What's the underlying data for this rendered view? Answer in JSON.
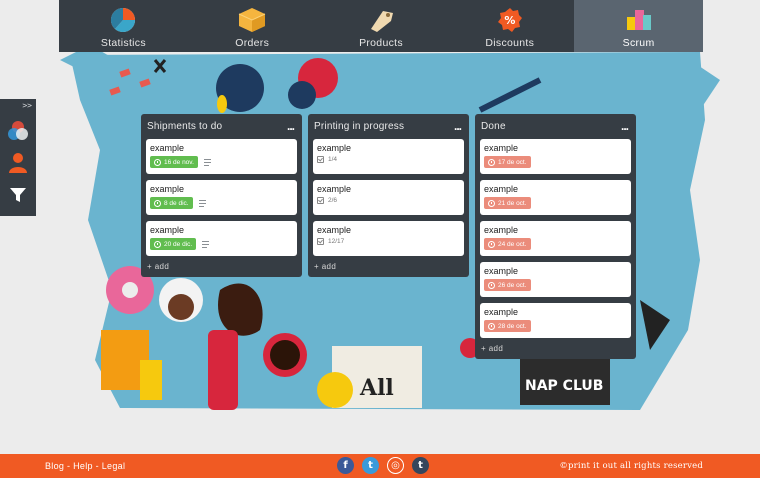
{
  "nav": {
    "items": [
      {
        "label": "Statistics",
        "icon": "pie-chart-icon",
        "active": false
      },
      {
        "label": "Orders",
        "icon": "box-icon",
        "active": false
      },
      {
        "label": "Products",
        "icon": "tag-icon",
        "active": false
      },
      {
        "label": "Discounts",
        "icon": "percent-icon",
        "active": false
      },
      {
        "label": "Scrum",
        "icon": "blocks-icon",
        "active": true
      }
    ]
  },
  "sidebar": {
    "expand_label": ">>",
    "icons": [
      "color-circles-icon",
      "user-icon",
      "filter-icon"
    ]
  },
  "board": {
    "lists": [
      {
        "title": "Shipments to do",
        "menu": "...",
        "add_label": "+ add",
        "cards": [
          {
            "title": "example",
            "due": "16 de nov.",
            "status": "green",
            "has_description": true
          },
          {
            "title": "example",
            "due": "8 de dic.",
            "status": "green",
            "has_description": true
          },
          {
            "title": "example",
            "due": "20 de dic.",
            "status": "green",
            "has_description": true
          }
        ]
      },
      {
        "title": "Printing in progress",
        "menu": "...",
        "add_label": "+ add",
        "cards": [
          {
            "title": "example",
            "checklist": "1/4"
          },
          {
            "title": "example",
            "checklist": "2/6"
          },
          {
            "title": "example",
            "checklist": "12/17"
          }
        ]
      },
      {
        "title": "Done",
        "menu": "...",
        "add_label": "+ add",
        "cards": [
          {
            "title": "example",
            "due": "17 de oct.",
            "status": "red"
          },
          {
            "title": "example",
            "due": "21 de oct.",
            "status": "red"
          },
          {
            "title": "example",
            "due": "24 de oct.",
            "status": "red"
          },
          {
            "title": "example",
            "due": "26 de oct.",
            "status": "red"
          },
          {
            "title": "example",
            "due": "28 de oct.",
            "status": "red"
          }
        ]
      }
    ]
  },
  "footer": {
    "links": "Blog - Help - Legal",
    "social": [
      {
        "name": "facebook-icon",
        "glyph": "f",
        "color": "#3b5998"
      },
      {
        "name": "twitter-icon",
        "glyph": "t",
        "color": "#3a9ad9"
      },
      {
        "name": "instagram-icon",
        "glyph": "◎",
        "color": "#f05a23"
      },
      {
        "name": "tumblr-icon",
        "glyph": "t",
        "color": "#35465c"
      }
    ],
    "copyright": "©print it out all rights reserved"
  },
  "colors": {
    "nav_bg": "#363d44",
    "accent": "#f05a23",
    "backdrop": "#6ab4cf",
    "due_green": "#61bd4f",
    "due_red": "#eb8c7b"
  }
}
